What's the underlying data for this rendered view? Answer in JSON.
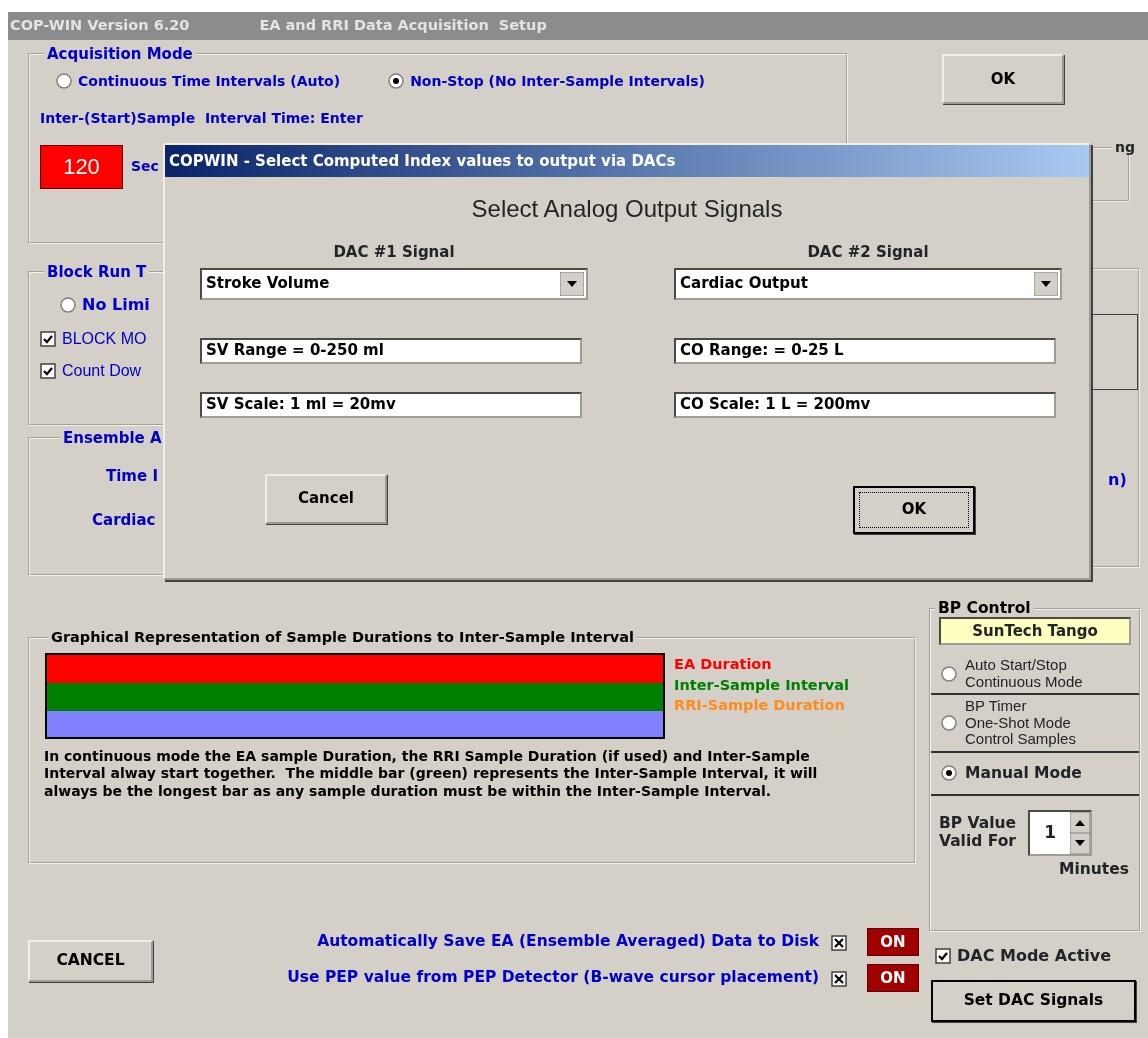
{
  "window": {
    "title": "COP-WIN Version 6.20",
    "subtitle": "EA and RRI Data Acquisition  Setup"
  },
  "ok_button": "OK",
  "acquisition_mode": {
    "legend": "Acquisition Mode",
    "options": [
      {
        "label": "Continuous Time Intervals (Auto)",
        "selected": false
      },
      {
        "label": "Non-Stop (No Inter-Sample Intervals)",
        "selected": true
      }
    ],
    "interval_label": "Inter-(Start)Sample  Interval Time: Enter",
    "interval_value": "120",
    "unit": "Sec"
  },
  "filter_group": {
    "legend": "ng"
  },
  "block_run": {
    "legend": "Block Run T",
    "radio": {
      "label": "No Limi",
      "selected": false
    },
    "checks": [
      {
        "label": "BLOCK MO",
        "checked": true
      },
      {
        "label": "Count Dow",
        "checked": true
      }
    ]
  },
  "ensemble": {
    "legend": "Ensemble A",
    "labels": [
      "Time I",
      "Cardiac"
    ]
  },
  "right_group": {
    "text": "n)"
  },
  "dialog": {
    "title": "COPWIN - Select Computed Index values to output via DACs",
    "heading": "Select Analog Output Signals",
    "dacs": [
      {
        "label": "DAC #1 Signal",
        "signal": "Stroke Volume",
        "range": "SV Range = 0-250 ml",
        "scale": "SV Scale: 1 ml = 20mv"
      },
      {
        "label": "DAC #2 Signal",
        "signal": "Cardiac Output",
        "range": "CO Range: = 0-25 L",
        "scale": "CO Scale: 1 L = 200mv"
      }
    ],
    "buttons": [
      {
        "label": "Cancel",
        "focused": false
      },
      {
        "label": "OK",
        "focused": true
      }
    ]
  },
  "graph": {
    "legend": "Graphical Representation of Sample Durations to Inter-Sample Interval",
    "bars": [
      {
        "color": "#ff0000"
      },
      {
        "color": "#008000"
      },
      {
        "color": "#8080ff"
      }
    ],
    "legend_items": [
      {
        "label": "EA Duration",
        "color": "#ff0000"
      },
      {
        "label": "Inter-Sample Interval",
        "color": "#008000"
      },
      {
        "label": "RRI-Sample Duration",
        "color": "#ff8c1a"
      }
    ],
    "description": "In continuous mode the EA sample Duration, the RRI Sample Duration (if used) and Inter-Sample Interval alway start together.  The middle bar (green) represents the Inter-Sample Interval, it will always be the longest bar as any sample duration must be within the Inter-Sample Interval."
  },
  "cancel_button": "CANCEL",
  "options": [
    {
      "label": "Automatically Save EA (Ensemble Averaged) Data to Disk",
      "checked": true,
      "status": "ON"
    },
    {
      "label": "Use PEP value from PEP Detector (B-wave cursor placement)",
      "checked": true,
      "status": "ON"
    }
  ],
  "bp_control": {
    "legend": "BP Control",
    "device": "SunTech Tango",
    "modes": [
      {
        "lines": [
          "Auto Start/Stop",
          "Continuous Mode"
        ],
        "selected": false,
        "kind": "plain"
      },
      {
        "lines": [
          "BP Timer",
          "One-Shot Mode",
          "Control Samples"
        ],
        "selected": false,
        "kind": "plain"
      },
      {
        "lines": [
          "Manual Mode"
        ],
        "selected": true,
        "kind": "bold"
      }
    ],
    "valid_lines": [
      "BP Value",
      "Valid For"
    ],
    "valid_value": "1",
    "unit": "Minutes"
  },
  "dac_mode": {
    "label": "DAC Mode Active",
    "checked": true
  },
  "set_dac_button": "Set DAC Signals"
}
